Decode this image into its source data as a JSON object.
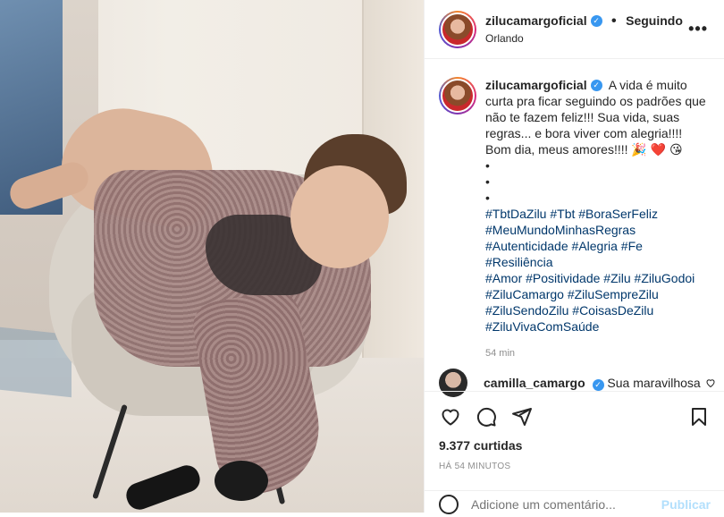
{
  "post": {
    "username": "zilucamargoficial",
    "verified_mark": "✓",
    "separator": "•",
    "follow_status": "Seguindo",
    "location": "Orlando",
    "more_icon": "more-options-icon",
    "more_glyph": "•••"
  },
  "caption": {
    "username": "zilucamargoficial",
    "text": "A vida é muito curta pra ficar seguindo os padrões que não te fazem feliz!!! Sua vida, suas regras... e bora viver com alegria!!!! Bom dia, meus amores!!!! 🎉 ❤️ 😘",
    "bullets": [
      "•",
      "•",
      "•"
    ],
    "hashtags": [
      "#TbtDaZilu",
      "#Tbt",
      "#BoraSerFeliz",
      "#MeuMundoMinhasRegras",
      "#Autenticidade",
      "#Alegria",
      "#Fe",
      "#Resiliência",
      "#Amor",
      "#Positividade",
      "#Zilu",
      "#ZiluGodoi",
      "#ZiluCamargo",
      "#ZiluSempreZilu",
      "#ZiluSendoZilu",
      "#CoisasDeZilu",
      "#ZiluVivaComSaúde"
    ],
    "age": "54 min"
  },
  "comment": {
    "username": "camilla_camargo",
    "text": "Sua maravilhosa",
    "verified_mark": "✓"
  },
  "actions": {
    "like_icon": "heart-icon",
    "comment_icon": "comment-icon",
    "share_icon": "share-icon",
    "save_icon": "bookmark-icon"
  },
  "likes": "9.377 curtidas",
  "posted_ago": "HÁ 54 MINUTOS",
  "comment_input": {
    "placeholder": "Adicione um comentário...",
    "publish_label": "Publicar"
  }
}
